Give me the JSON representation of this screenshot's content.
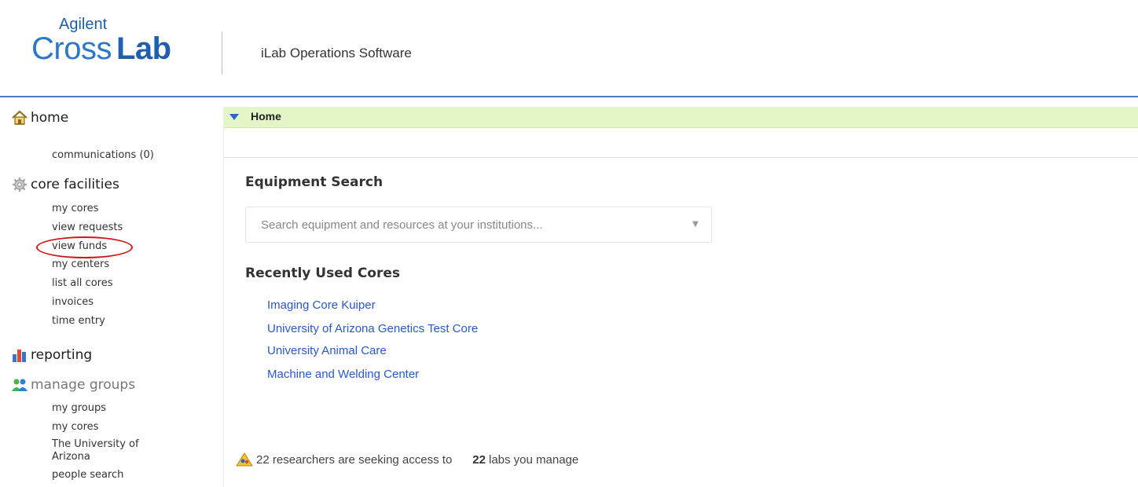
{
  "header": {
    "brand_top": "Agilent",
    "brand_cross": "Cross",
    "brand_lab": "Lab",
    "app_name": "iLab Operations Software"
  },
  "sidebar": {
    "home": {
      "label": "home",
      "icon": "home-icon",
      "items": [
        "communications (0)"
      ]
    },
    "core_facilities": {
      "label": "core facilities",
      "icon": "gear-icon",
      "items": [
        "my cores",
        "view requests",
        "view funds",
        "my centers",
        "list all cores",
        "invoices",
        "time entry"
      ]
    },
    "reporting": {
      "label": "reporting",
      "icon": "bar-chart-icon"
    },
    "manage_groups": {
      "label": "manage groups",
      "icon": "group-icon",
      "items": [
        "my groups",
        "my cores",
        "The University of Arizona",
        "people search"
      ]
    }
  },
  "main": {
    "breadcrumb": "Home",
    "equipment_search": {
      "title": "Equipment Search",
      "placeholder": "Search equipment and resources at your institutions...",
      "dropdown_glyph": "▼"
    },
    "recent_cores": {
      "title": "Recently Used Cores",
      "items": [
        "Imaging Core Kuiper",
        "University of Arizona Genetics Test Core",
        "University Animal Care",
        "Machine and Welding Center"
      ]
    },
    "notice": {
      "text": "22 researchers are seeking access to",
      "count": "22",
      "suffix": "labs you manage",
      "icon": "warning-icon"
    }
  },
  "colors": {
    "accent": "#2a57c9",
    "header_rule": "#4f79b5",
    "home_bar": "#e4f6c8",
    "highlight_ring": "#d01818"
  }
}
